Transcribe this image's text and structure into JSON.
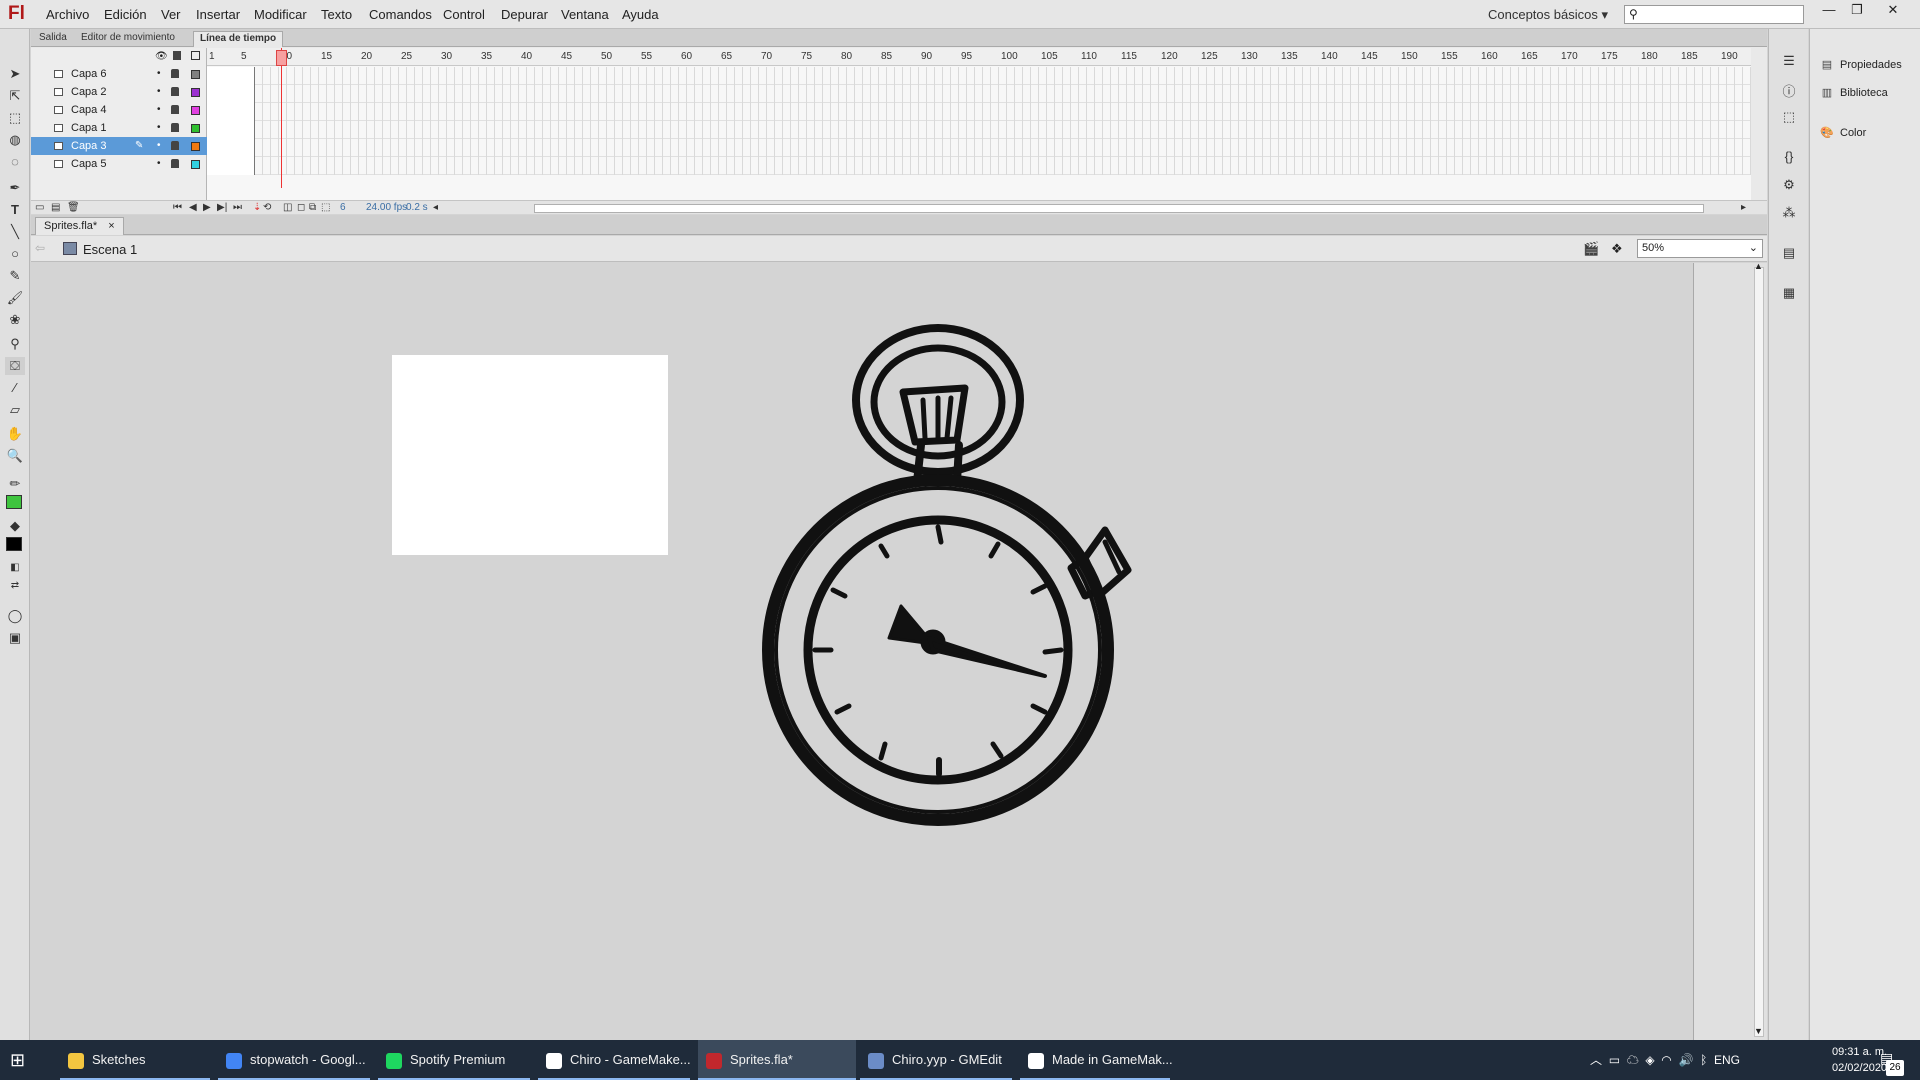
{
  "app": {
    "logo": "Fl"
  },
  "menu": [
    "Archivo",
    "Edición",
    "Ver",
    "Insertar",
    "Modificar",
    "Texto",
    "Comandos",
    "Control",
    "Depurar",
    "Ventana",
    "Ayuda"
  ],
  "workspace": "Conceptos básicos ▾",
  "search": {
    "placeholder": "",
    "icon": "⚲"
  },
  "window_controls": {
    "minimize": "—",
    "restore": "❐",
    "close": "✕"
  },
  "timeline": {
    "tabs": [
      "Salida",
      "Editor de movimiento",
      "Línea de tiempo"
    ],
    "active_tab": "Línea de tiempo",
    "layers": [
      {
        "name": "Capa 6",
        "color": "#808080",
        "selected": false
      },
      {
        "name": "Capa 2",
        "color": "#9b30d0",
        "selected": false
      },
      {
        "name": "Capa 4",
        "color": "#e040e0",
        "selected": false
      },
      {
        "name": "Capa 1",
        "color": "#30c030",
        "selected": false
      },
      {
        "name": "Capa 3",
        "color": "#f07a10",
        "selected": true
      },
      {
        "name": "Capa 5",
        "color": "#30d0e0",
        "selected": false
      }
    ],
    "ruler": [
      "1",
      "5",
      "10",
      "15",
      "20",
      "25",
      "30",
      "35",
      "40",
      "45",
      "50",
      "55",
      "60",
      "65",
      "70",
      "75",
      "80",
      "85",
      "90",
      "95",
      "100",
      "105",
      "110",
      "115",
      "120",
      "125",
      "130",
      "135",
      "140",
      "145",
      "150",
      "155",
      "160",
      "165",
      "170",
      "175",
      "180",
      "185",
      "190"
    ],
    "current_frame": "6",
    "fps": "24.00 fps",
    "time": "0.2 s"
  },
  "document": {
    "tab": "Sprites.fla*",
    "close": "×",
    "scene": "Escena 1",
    "zoom": "50%"
  },
  "right_panel": {
    "items": [
      "Propiedades",
      "Biblioteca",
      "Color"
    ]
  },
  "taskbar": {
    "apps": [
      {
        "label": "Sketches",
        "color": "#f3c640"
      },
      {
        "label": "stopwatch - Googl...",
        "color": "#4285f4"
      },
      {
        "label": "Spotify Premium",
        "color": "#1ed760"
      },
      {
        "label": "Chiro - GameMake...",
        "color": "#ffffff"
      },
      {
        "label": "Sprites.fla*",
        "color": "#c1272d"
      },
      {
        "label": "Chiro.yyp - GMEdit",
        "color": "#6b8cc7"
      },
      {
        "label": "Made in GameMak...",
        "color": "#ffffff"
      }
    ],
    "active_app": "Sprites.fla*",
    "lang": "ENG",
    "time": "09:31 a. m.",
    "date": "02/02/2020",
    "notifications": "26"
  }
}
